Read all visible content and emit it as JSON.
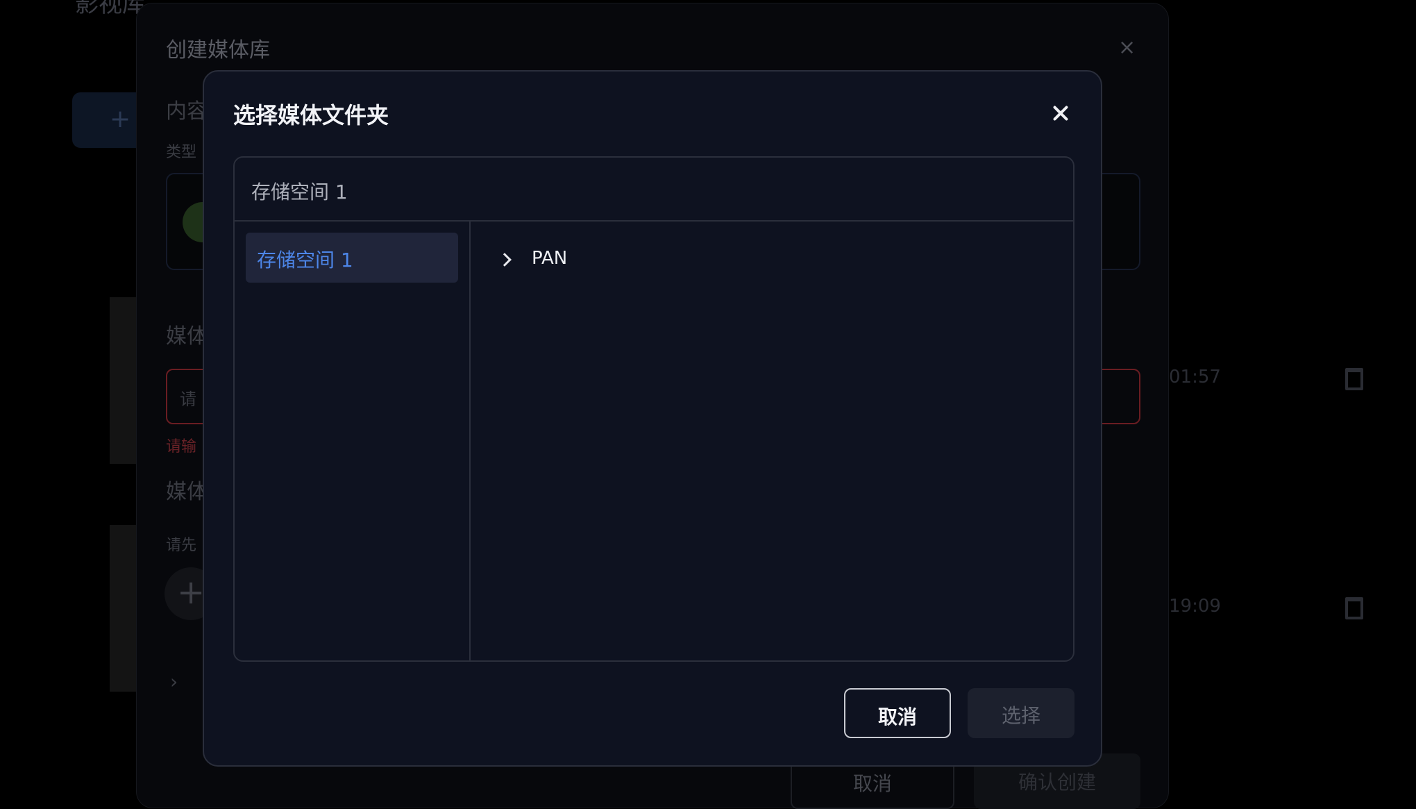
{
  "background": {
    "page_title": "影视库",
    "add_symbol": "+",
    "rows": [
      {
        "time": "01:57"
      },
      {
        "time": "19:09"
      }
    ]
  },
  "outer_dialog": {
    "title": "创建媒体库",
    "close_symbol": "×",
    "section_content": "内容",
    "type_label": "类型",
    "section_media": "媒体",
    "input_placeholder": "请",
    "error_text": "请输",
    "section_media2": "媒体",
    "hint_text": "请先",
    "add_symbol": "+",
    "expand_symbol": "›",
    "cancel_label": "取消",
    "confirm_label": "确认创建"
  },
  "modal": {
    "title": "选择媒体文件夹",
    "path": "存储空间 1",
    "storages": [
      {
        "label": "存储空间 1",
        "selected": true
      }
    ],
    "folders": [
      {
        "name": "PAN"
      }
    ],
    "cancel_label": "取消",
    "select_label": "选择",
    "select_enabled": false
  },
  "colors": {
    "modal_bg": "#0e1220",
    "accent": "#4d86e8",
    "error": "#6a2227"
  }
}
